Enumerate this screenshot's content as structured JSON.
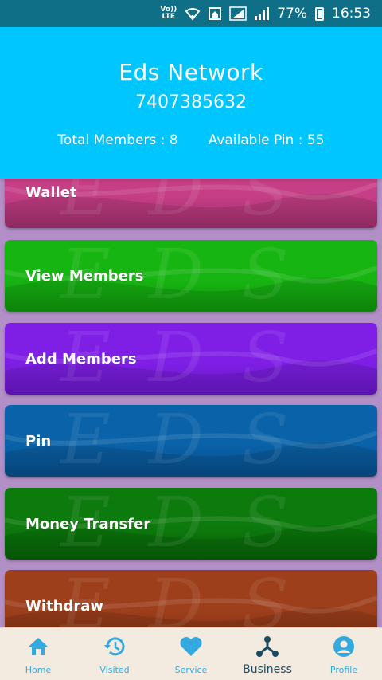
{
  "status_bar": {
    "volte_top": "Vo))",
    "volte_bottom": "LTE",
    "battery": "77%",
    "time": "16:53"
  },
  "header": {
    "title": "Eds Network",
    "phone": "7407385632",
    "total_members_label": "Total Members : 8",
    "available_pin_label": "Available Pin : 55"
  },
  "watermark": "EDS",
  "cards": [
    {
      "label": "Wallet",
      "color": "#c63f86",
      "color_dark": "#9f2f6c"
    },
    {
      "label": "View Members",
      "color": "#17b512",
      "color_dark": "#0f920b"
    },
    {
      "label": "Add Members",
      "color": "#7f1fe6",
      "color_dark": "#6616c2"
    },
    {
      "label": "Pin",
      "color": "#0a62a8",
      "color_dark": "#074c87"
    },
    {
      "label": "Money Transfer",
      "color": "#0c7a0c",
      "color_dark": "#075e07"
    },
    {
      "label": "Withdraw",
      "color": "#9e3f1c",
      "color_dark": "#7e2f13"
    }
  ],
  "bottom_nav": [
    {
      "label": "Home",
      "icon": "home-icon",
      "active": false
    },
    {
      "label": "Visited",
      "icon": "history-icon",
      "active": false
    },
    {
      "label": "Service",
      "icon": "heart-icon",
      "active": false
    },
    {
      "label": "Business",
      "icon": "network-icon",
      "active": true
    },
    {
      "label": "Profile",
      "icon": "profile-icon",
      "active": false
    }
  ],
  "colors": {
    "status_bar": "#0f6f86",
    "header": "#00c6ff",
    "background": "#b28fc6",
    "nav_bg": "#f4ebe0",
    "nav_icon": "#33a9e0",
    "nav_active": "#1b4a60"
  }
}
